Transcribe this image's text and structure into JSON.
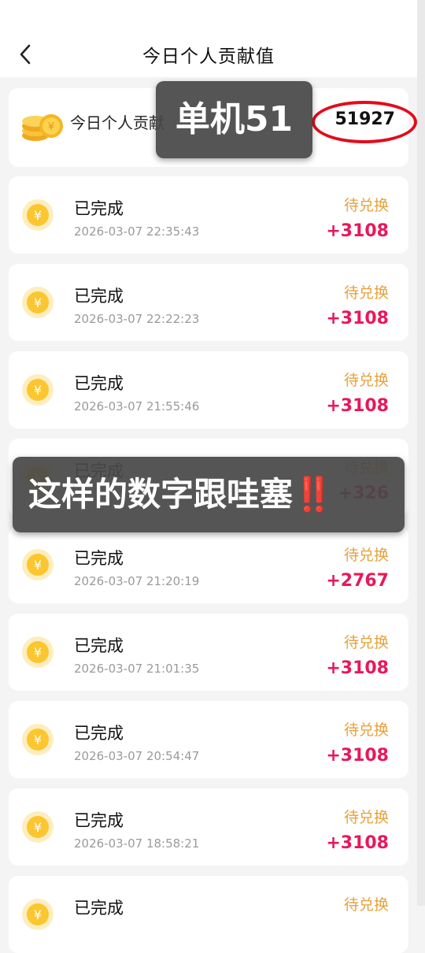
{
  "header": {
    "title": "今日个人贡献值"
  },
  "summary": {
    "label": "今日个人贡献",
    "value": "51927"
  },
  "overlays": {
    "top": "单机51",
    "middle": "这样的数字跟哇塞",
    "middle_mark": "‼️"
  },
  "records": [
    {
      "status": "已完成",
      "time": "2026-03-07 22:35:43",
      "exchange": "待兑换",
      "amount": "+3108"
    },
    {
      "status": "已完成",
      "time": "2026-03-07 22:22:23",
      "exchange": "待兑换",
      "amount": "+3108"
    },
    {
      "status": "已完成",
      "time": "2026-03-07 21:55:46",
      "exchange": "待兑换",
      "amount": "+3108"
    },
    {
      "status": "已完成",
      "time": "",
      "exchange": "待兑换",
      "amount": "+326"
    },
    {
      "status": "已完成",
      "time": "2026-03-07 21:20:19",
      "exchange": "待兑换",
      "amount": "+2767"
    },
    {
      "status": "已完成",
      "time": "2026-03-07 21:01:35",
      "exchange": "待兑换",
      "amount": "+3108"
    },
    {
      "status": "已完成",
      "time": "2026-03-07 20:54:47",
      "exchange": "待兑换",
      "amount": "+3108"
    },
    {
      "status": "已完成",
      "time": "2026-03-07 18:58:21",
      "exchange": "待兑换",
      "amount": "+3108"
    },
    {
      "status": "已完成",
      "time": "",
      "exchange": "待兑换",
      "amount": ""
    }
  ]
}
